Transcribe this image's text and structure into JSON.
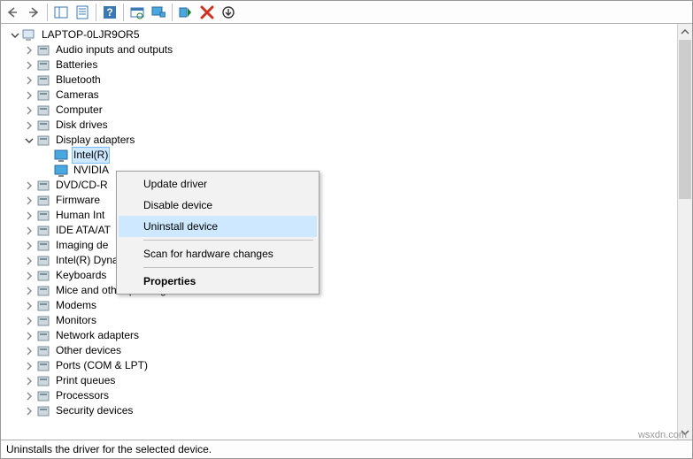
{
  "root_label": "LAPTOP-0LJR9OR5",
  "categories": [
    {
      "label": "Audio inputs and outputs",
      "exp": "closed"
    },
    {
      "label": "Batteries",
      "exp": "closed"
    },
    {
      "label": "Bluetooth",
      "exp": "closed"
    },
    {
      "label": "Cameras",
      "exp": "closed"
    },
    {
      "label": "Computer",
      "exp": "closed"
    },
    {
      "label": "Disk drives",
      "exp": "closed"
    },
    {
      "label": "Display adapters",
      "exp": "open",
      "children": [
        {
          "label": "Intel(R)",
          "selected": true
        },
        {
          "label": "NVIDIA"
        }
      ]
    },
    {
      "label": "DVD/CD-R",
      "exp": "closed"
    },
    {
      "label": "Firmware",
      "exp": "closed"
    },
    {
      "label": "Human Int",
      "exp": "closed"
    },
    {
      "label": "IDE ATA/AT",
      "exp": "closed"
    },
    {
      "label": "Imaging de",
      "exp": "closed"
    },
    {
      "label": "Intel(R) Dynamic Platform and Thermal Framework",
      "exp": "closed"
    },
    {
      "label": "Keyboards",
      "exp": "closed"
    },
    {
      "label": "Mice and other pointing devices",
      "exp": "closed"
    },
    {
      "label": "Modems",
      "exp": "closed"
    },
    {
      "label": "Monitors",
      "exp": "closed"
    },
    {
      "label": "Network adapters",
      "exp": "closed"
    },
    {
      "label": "Other devices",
      "exp": "closed"
    },
    {
      "label": "Ports (COM & LPT)",
      "exp": "closed"
    },
    {
      "label": "Print queues",
      "exp": "closed"
    },
    {
      "label": "Processors",
      "exp": "closed"
    },
    {
      "label": "Security devices",
      "exp": "closed"
    }
  ],
  "context_menu": {
    "items": [
      {
        "label": "Update driver"
      },
      {
        "label": "Disable device"
      },
      {
        "label": "Uninstall device",
        "hover": true
      },
      {
        "sep": true
      },
      {
        "label": "Scan for hardware changes"
      },
      {
        "sep": true
      },
      {
        "label": "Properties",
        "bold": true
      }
    ]
  },
  "status_text": "Uninstalls the driver for the selected device.",
  "watermark": "wsxdn.com"
}
